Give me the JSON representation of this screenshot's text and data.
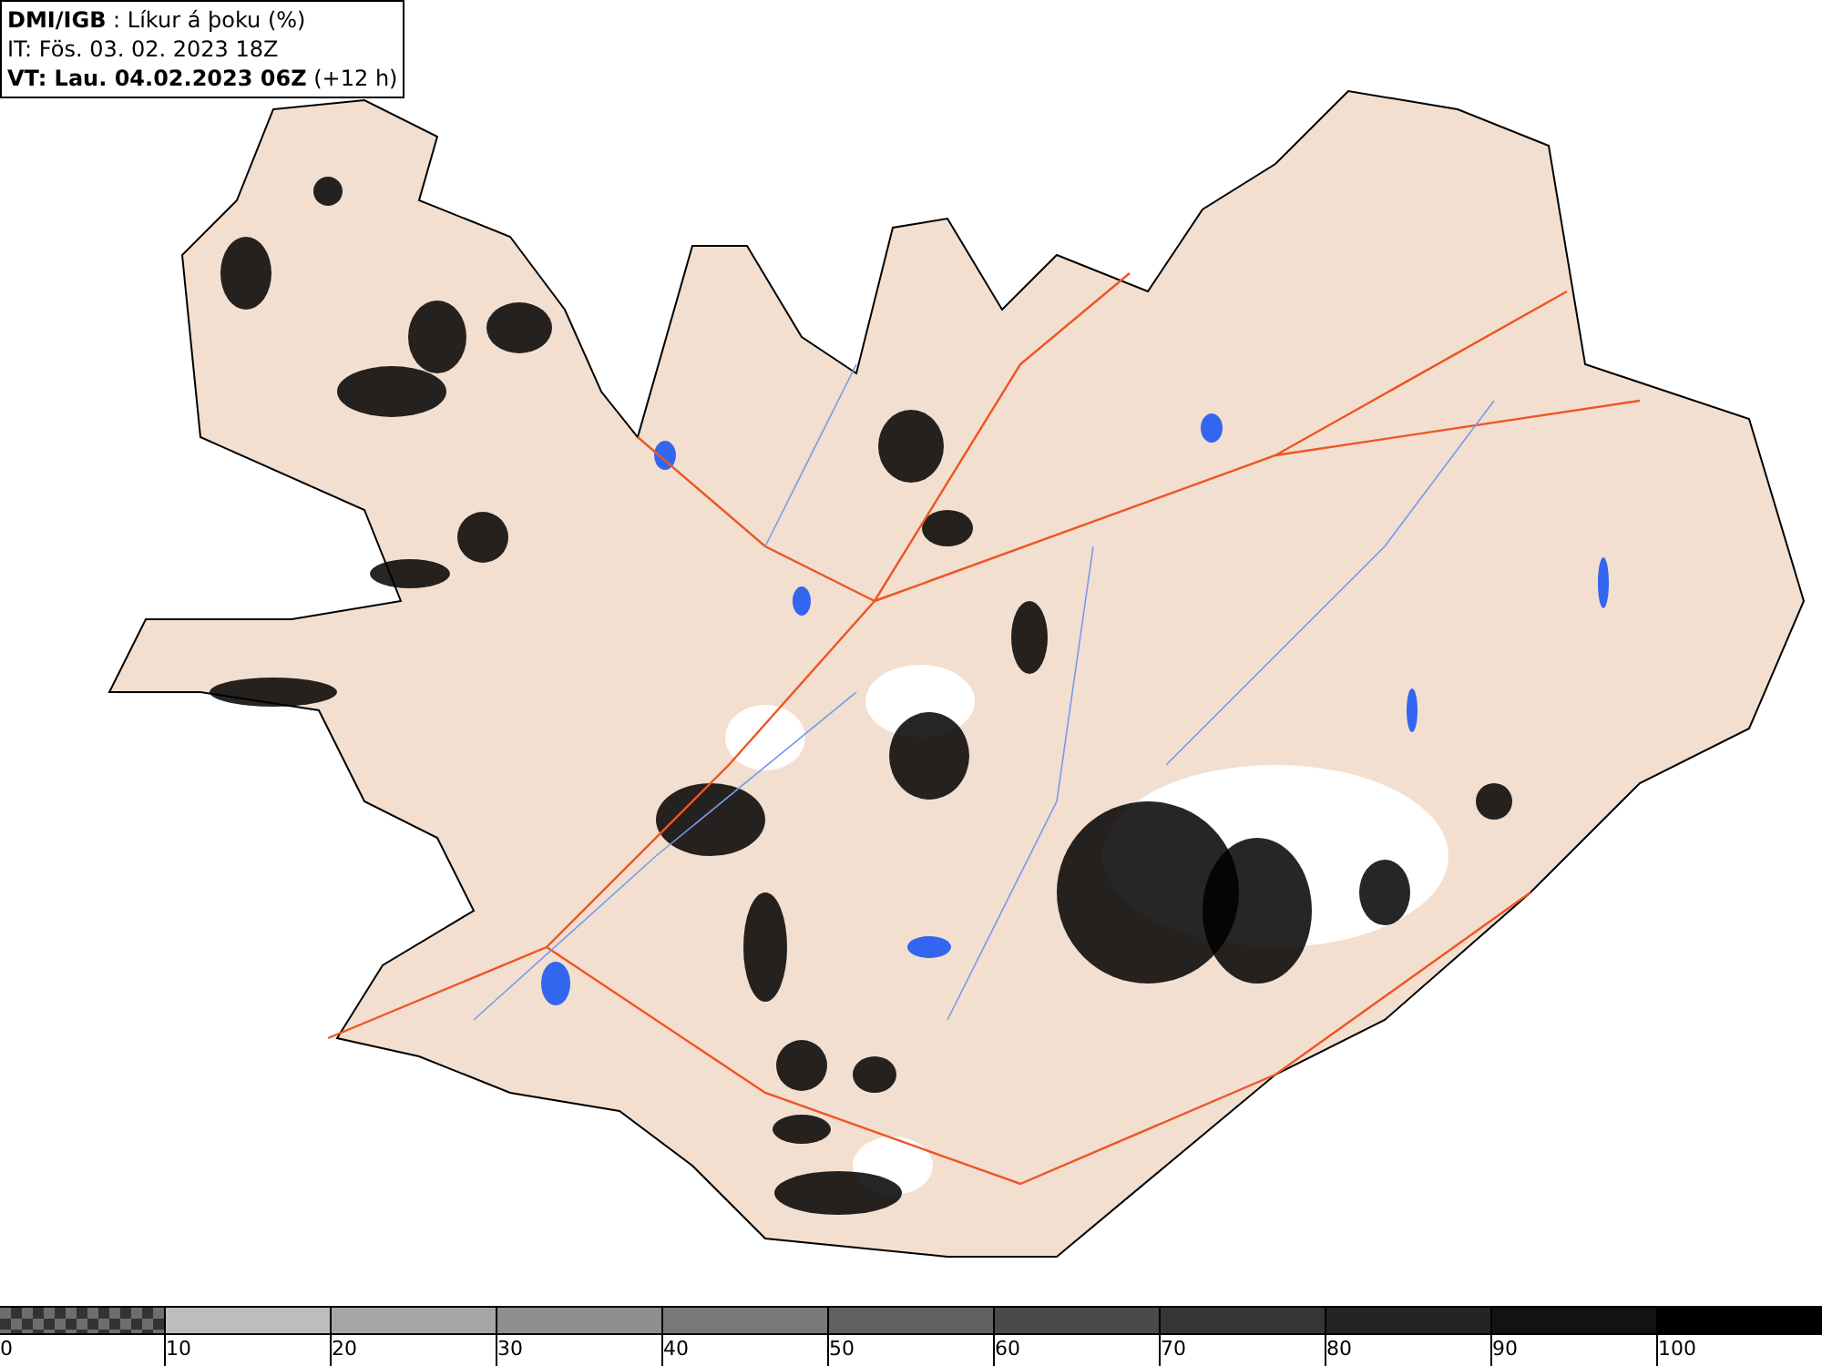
{
  "header": {
    "title": "**DMI/IGB** : Líkur á þoku (%)",
    "issue_time": "IT: Fös. 03. 02. 2023 18Z",
    "valid_time": "**VT: Lau. 04.02.2023 06Z** (+12 h)"
  },
  "legend": {
    "bins": [
      {
        "kind": "checker",
        "color": "#6e6e6e"
      },
      {
        "kind": "solid",
        "color": "#bdbdbd"
      },
      {
        "kind": "solid",
        "color": "#a6a6a6"
      },
      {
        "kind": "solid",
        "color": "#8f8f8f"
      },
      {
        "kind": "solid",
        "color": "#787878"
      },
      {
        "kind": "solid",
        "color": "#616161"
      },
      {
        "kind": "solid",
        "color": "#4a4a4a"
      },
      {
        "kind": "solid",
        "color": "#363636"
      },
      {
        "kind": "solid",
        "color": "#242424"
      },
      {
        "kind": "solid",
        "color": "#121212"
      },
      {
        "kind": "solid",
        "color": "#000000"
      }
    ],
    "ticks": [
      "0",
      "10",
      "20",
      "30",
      "40",
      "50",
      "60",
      "70",
      "80",
      "90",
      "100"
    ]
  }
}
